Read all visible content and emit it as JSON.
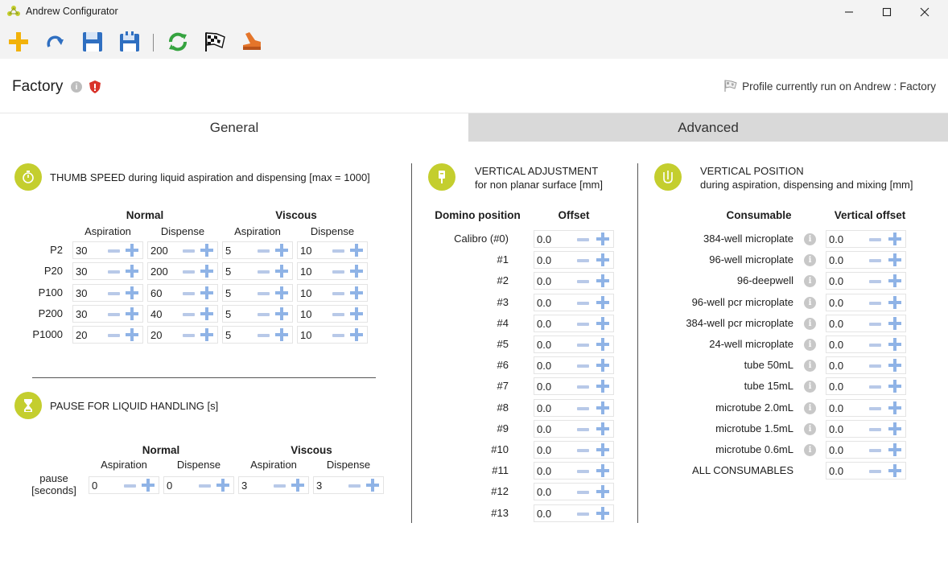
{
  "window": {
    "title": "Andrew Configurator"
  },
  "toolbar": {
    "buttons": [
      {
        "name": "add-icon"
      },
      {
        "name": "redo-icon"
      },
      {
        "name": "save-icon"
      },
      {
        "name": "save-as-icon"
      },
      {
        "name": "refresh-icon"
      },
      {
        "name": "checkered-flag-icon"
      },
      {
        "name": "pipette-icon"
      }
    ]
  },
  "profile": {
    "name": "Factory",
    "status": "Profile currently run on Andrew : Factory",
    "info_glyph": "i"
  },
  "tabs": [
    {
      "label": "General",
      "selected": true
    },
    {
      "label": "Advanced",
      "selected": false
    }
  ],
  "colors": {
    "accent": "#c4ce2e",
    "plus": "#8fb3e6",
    "minus": "#b8c9e8",
    "shield": "#d9342b"
  },
  "thumb_speed": {
    "title": "THUMB SPEED during liquid aspiration and dispensing [max = 1000]",
    "groups": [
      "Normal",
      "Viscous"
    ],
    "columns": [
      "Aspiration",
      "Dispense",
      "Aspiration",
      "Dispense"
    ],
    "rows": [
      {
        "label": "P2",
        "values": [
          "30",
          "200",
          "5",
          "10"
        ]
      },
      {
        "label": "P20",
        "values": [
          "30",
          "200",
          "5",
          "10"
        ]
      },
      {
        "label": "P100",
        "values": [
          "30",
          "60",
          "5",
          "10"
        ]
      },
      {
        "label": "P200",
        "values": [
          "30",
          "40",
          "5",
          "10"
        ]
      },
      {
        "label": "P1000",
        "values": [
          "20",
          "20",
          "5",
          "10"
        ]
      }
    ]
  },
  "pause": {
    "title": "PAUSE FOR LIQUID HANDLING [s]",
    "groups": [
      "Normal",
      "Viscous"
    ],
    "columns": [
      "Aspiration",
      "Dispense",
      "Aspiration",
      "Dispense"
    ],
    "row_label_line1": "pause",
    "row_label_line2": "[seconds]",
    "values": [
      "0",
      "0",
      "3",
      "3"
    ]
  },
  "vertical_adjustment": {
    "title_line1": "VERTICAL ADJUSTMENT",
    "title_line2": "for non planar surface [mm]",
    "col_position": "Domino position",
    "col_offset": "Offset",
    "rows": [
      {
        "label": "Calibro (#0)",
        "value": "0.0"
      },
      {
        "label": "#1",
        "value": "0.0"
      },
      {
        "label": "#2",
        "value": "0.0"
      },
      {
        "label": "#3",
        "value": "0.0"
      },
      {
        "label": "#4",
        "value": "0.0"
      },
      {
        "label": "#5",
        "value": "0.0"
      },
      {
        "label": "#6",
        "value": "0.0"
      },
      {
        "label": "#7",
        "value": "0.0"
      },
      {
        "label": "#8",
        "value": "0.0"
      },
      {
        "label": "#9",
        "value": "0.0"
      },
      {
        "label": "#10",
        "value": "0.0"
      },
      {
        "label": "#11",
        "value": "0.0"
      },
      {
        "label": "#12",
        "value": "0.0"
      },
      {
        "label": "#13",
        "value": "0.0"
      }
    ]
  },
  "vertical_position": {
    "title_line1": "VERTICAL POSITION",
    "title_line2": "during aspiration, dispensing and mixing [mm]",
    "col_consumable": "Consumable",
    "col_offset": "Vertical offset",
    "rows": [
      {
        "label": "384-well microplate",
        "value": "0.0",
        "info": true
      },
      {
        "label": "96-well microplate",
        "value": "0.0",
        "info": true
      },
      {
        "label": "96-deepwell",
        "value": "0.0",
        "info": true
      },
      {
        "label": "96-well pcr microplate",
        "value": "0.0",
        "info": true
      },
      {
        "label": "384-well pcr microplate",
        "value": "0.0",
        "info": true
      },
      {
        "label": "24-well microplate",
        "value": "0.0",
        "info": true
      },
      {
        "label": "tube 50mL",
        "value": "0.0",
        "info": true
      },
      {
        "label": "tube 15mL",
        "value": "0.0",
        "info": true
      },
      {
        "label": "microtube 2.0mL",
        "value": "0.0",
        "info": true
      },
      {
        "label": "microtube 1.5mL",
        "value": "0.0",
        "info": true
      },
      {
        "label": "microtube 0.6mL",
        "value": "0.0",
        "info": true
      },
      {
        "label": "ALL CONSUMABLES",
        "value": "0.0",
        "info": false
      }
    ]
  }
}
